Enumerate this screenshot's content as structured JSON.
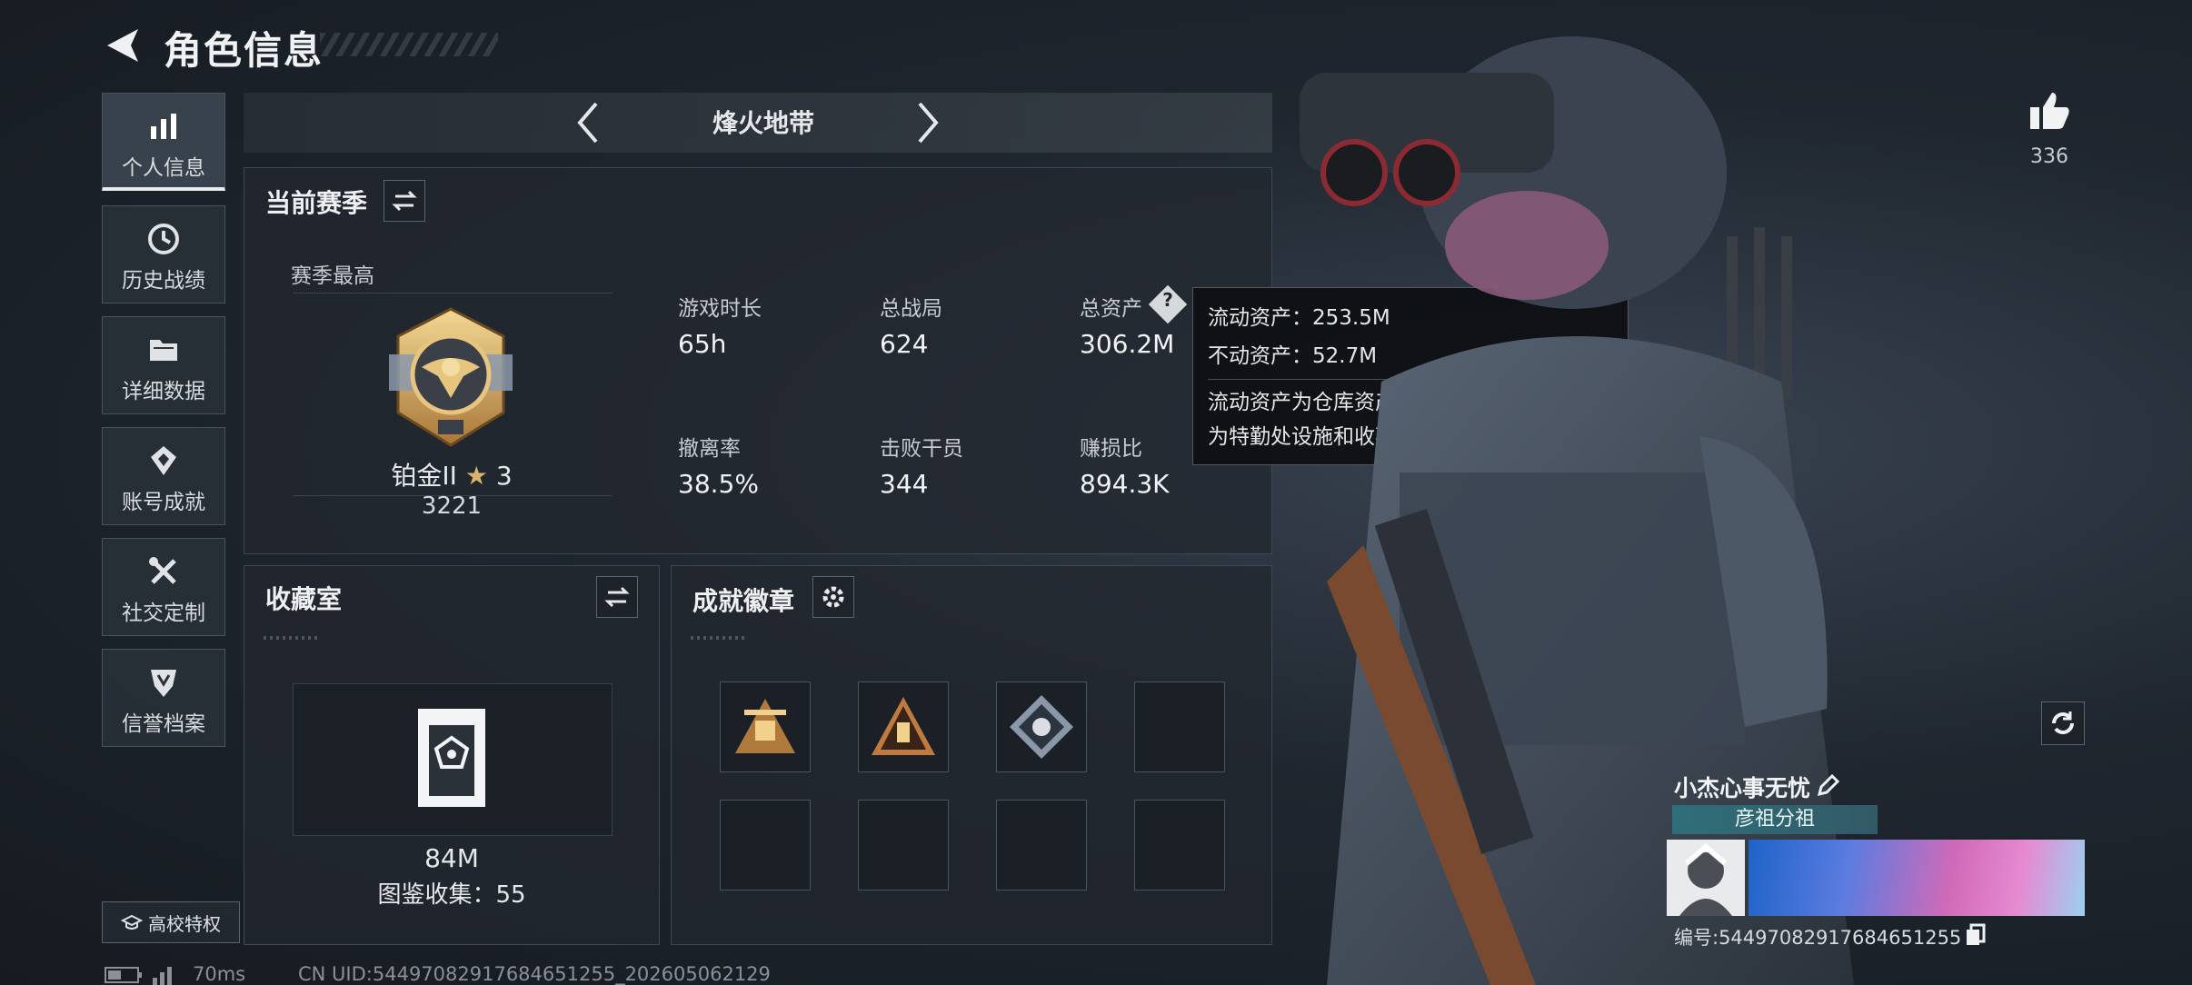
{
  "header": {
    "title": "角色信息"
  },
  "sidebar": {
    "items": [
      {
        "label": "个人信息"
      },
      {
        "label": "历史战绩"
      },
      {
        "label": "详细数据"
      },
      {
        "label": "账号成就"
      },
      {
        "label": "社交定制"
      },
      {
        "label": "信誉档案"
      }
    ],
    "campus_label": "高校特权"
  },
  "mode_selector": {
    "label": "烽火地带"
  },
  "season": {
    "title": "当前赛季",
    "best_label": "赛季最高",
    "rank_name": "铂金II",
    "rank_stars": "3",
    "rank_score": "3221",
    "stats": [
      {
        "label": "游戏时长",
        "value": "65h"
      },
      {
        "label": "总战局",
        "value": "624"
      },
      {
        "label": "总资产",
        "value": "306.2M"
      },
      {
        "label": "撤离率",
        "value": "38.5%"
      },
      {
        "label": "击败干员",
        "value": "344"
      },
      {
        "label": "赚损比",
        "value": "894.3K"
      }
    ]
  },
  "tooltip": {
    "line1": "流动资产：253.5M",
    "line2": "不动资产：52.7M",
    "desc1": "流动资产为仓库资产和哈夫币，不动资产",
    "desc2": "为特勤处设施和收藏室设施"
  },
  "collection": {
    "title": "收藏室",
    "value": "84M",
    "catalog": "图鉴收集：55"
  },
  "badges": {
    "title": "成就徽章"
  },
  "likes": {
    "count": "336"
  },
  "profile": {
    "name": "小杰心事无忧",
    "title_tag": "彦祖分祖",
    "id_text": "编号:5449708291768465125​5"
  },
  "status_bar": {
    "ping": "70ms",
    "uid": "CN UID:5449708291768465125​5_202605062129"
  },
  "colors": {
    "accent": "#d9b46a",
    "tag_bg": "#2f6f7a",
    "panel": "#22282f"
  }
}
